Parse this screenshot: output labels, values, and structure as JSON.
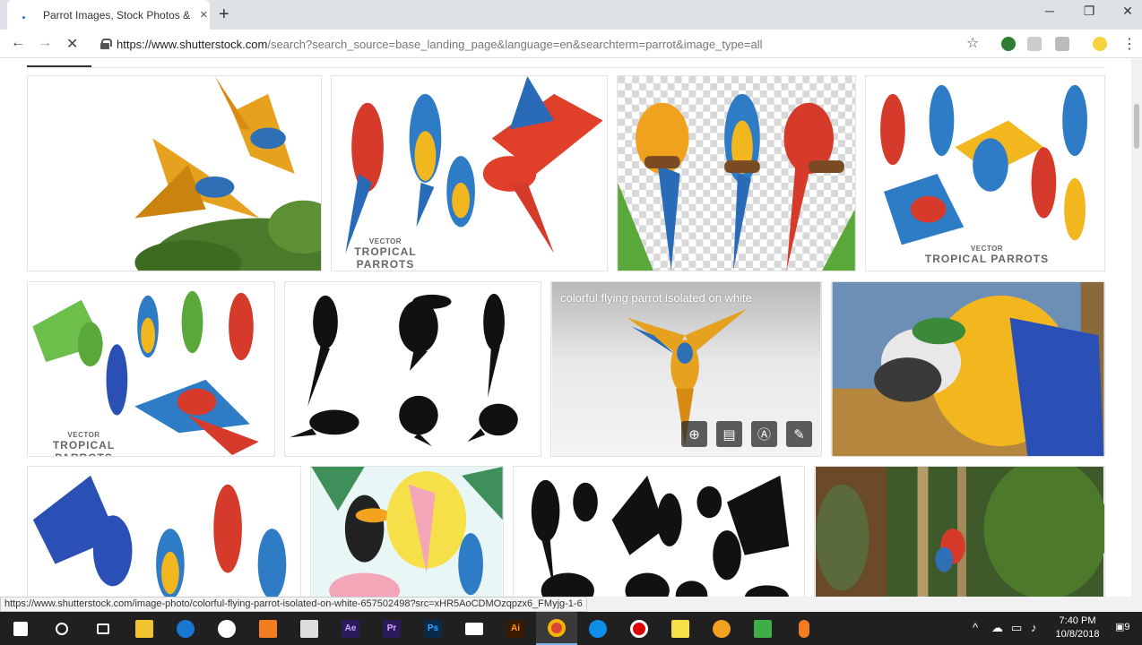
{
  "browser": {
    "tab_title": "Parrot Images, Stock Photos & Vectors | Shutterstock",
    "tab_close": "×",
    "new_tab": "+",
    "window": {
      "minimize": "─",
      "maximize": "❐",
      "close": "✕"
    },
    "nav": {
      "back": "←",
      "forward": "→",
      "stop": "✕"
    },
    "url_host": "https://www.shutterstock.com",
    "url_path": "/search?search_source=base_landing_page&language=en&searchterm=parrot&image_type=all",
    "bookmark_star": "☆",
    "menu": "⋮"
  },
  "results": {
    "row1": [
      {
        "id": "flying-macaws-photo"
      },
      {
        "id": "tropical-parrots-vector-1",
        "caption_small": "VECTOR",
        "caption": "TROPICAL PARROTS"
      },
      {
        "id": "macaws-transparent"
      },
      {
        "id": "tropical-parrots-vector-2",
        "caption_small": "VECTOR",
        "caption": "TROPICAL PARROTS"
      }
    ],
    "row2": [
      {
        "id": "tropical-parrots-vector-3",
        "caption_small": "VECTOR",
        "caption": "TROPICAL PARROTS"
      },
      {
        "id": "bird-silhouettes"
      },
      {
        "id": "flying-parrot-hover",
        "overlay": "colorful flying parrot isolated on white"
      },
      {
        "id": "macaw-closeup-photo"
      }
    ],
    "actions": {
      "add": "⊕",
      "lightbox": "▤",
      "similar": "Ⓐ",
      "edit": "✎"
    }
  },
  "status_url": "https://www.shutterstock.com/image-photo/colorful-flying-parrot-isolated-on-white-657502498?src=xHR5AoCDMOzqpzx6_FMyjg-1-6",
  "taskbar": {
    "apps": [
      "windows",
      "cortana",
      "task-view",
      "file-explorer",
      "edge",
      "xbox",
      "media",
      "store",
      "after-effects",
      "premiere",
      "photoshop",
      "mail",
      "illustrator",
      "chrome",
      "teamviewer",
      "recorder",
      "notes",
      "emoji",
      "camtasia",
      "microphone"
    ],
    "ae_label": "Ae",
    "pr_label": "Pr",
    "ps_label": "Ps",
    "ai_label": "Ai",
    "time": "7:40 PM",
    "date": "10/8/2018",
    "notifications": "9"
  }
}
